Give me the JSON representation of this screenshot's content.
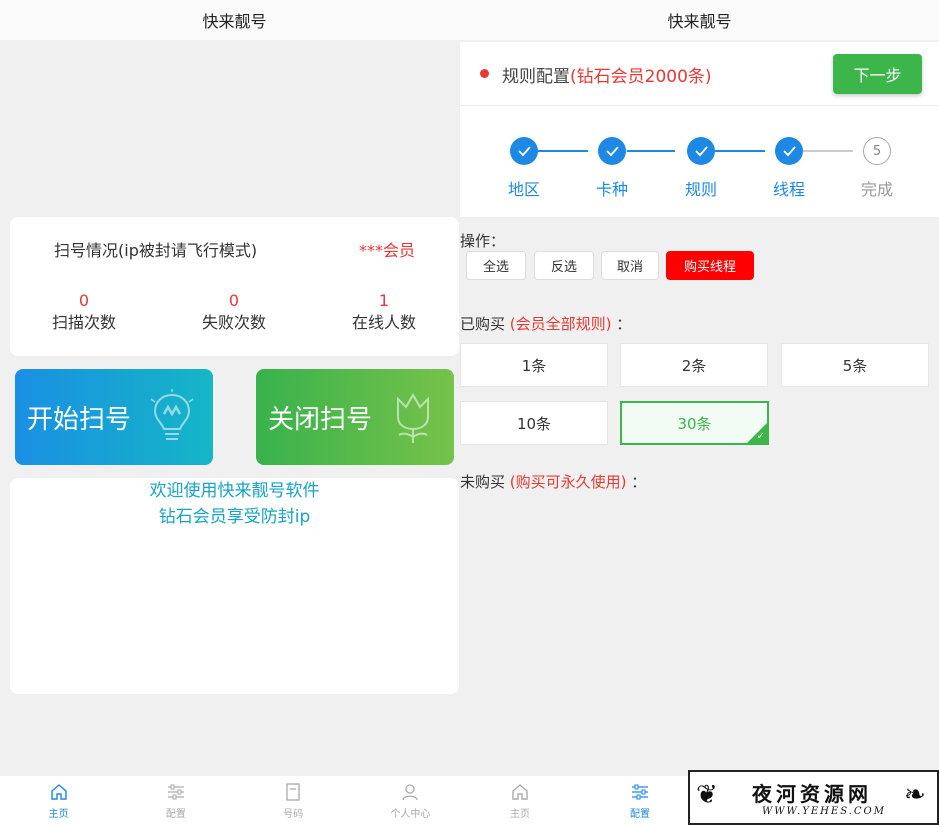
{
  "left": {
    "title": "快来靓号",
    "status": {
      "title": "扫号情况(ip被封请飞行模式)",
      "member_badge": "***会员",
      "stats": [
        {
          "value": "0",
          "label": "扫描次数"
        },
        {
          "value": "0",
          "label": "失败次数"
        },
        {
          "value": "1",
          "label": "在线人数"
        }
      ]
    },
    "start_button": "开始扫号",
    "stop_button": "关闭扫号",
    "welcome_line1": "欢迎使用快来靓号软件",
    "welcome_line2": "钻石会员享受防封ip",
    "nav": [
      {
        "label": "主页",
        "icon": "home-icon",
        "active": true
      },
      {
        "label": "配置",
        "icon": "sliders-icon",
        "active": false
      },
      {
        "label": "号码",
        "icon": "document-icon",
        "active": false
      },
      {
        "label": "个人中心",
        "icon": "user-icon",
        "active": false
      }
    ]
  },
  "right": {
    "title": "快来靓号",
    "rule_title_prefix": "规则配置",
    "rule_title_highlight": "(钻石会员2000条)",
    "next_button": "下一步",
    "steps": [
      {
        "label": "地区",
        "done": true
      },
      {
        "label": "卡种",
        "done": true
      },
      {
        "label": "规则",
        "done": true
      },
      {
        "label": "线程",
        "done": true
      },
      {
        "label": "完成",
        "done": false,
        "number": "5"
      }
    ],
    "ops_label": "操作：",
    "ops": [
      "全选",
      "反选",
      "取消",
      "购买线程"
    ],
    "purchased_prefix": "已购买",
    "purchased_highlight": "(会员全部规则)",
    "purchased_suffix": "：",
    "options": [
      {
        "label": "1条",
        "selected": false
      },
      {
        "label": "2条",
        "selected": false
      },
      {
        "label": "5条",
        "selected": false
      },
      {
        "label": "10条",
        "selected": false
      },
      {
        "label": "30条",
        "selected": true
      }
    ],
    "unpurchased_prefix": "未购买",
    "unpurchased_highlight": "(购买可永久使用)",
    "unpurchased_suffix": "：",
    "nav": [
      {
        "label": "主页",
        "icon": "home-icon",
        "active": false
      },
      {
        "label": "配置",
        "icon": "sliders-icon",
        "active": true
      }
    ]
  },
  "watermark": {
    "main": "夜河资源网",
    "url": "WWW.YEHES.COM"
  },
  "colors": {
    "accent_blue": "#1e88e5",
    "accent_red": "#e53935",
    "accent_green": "#3cb54a"
  }
}
